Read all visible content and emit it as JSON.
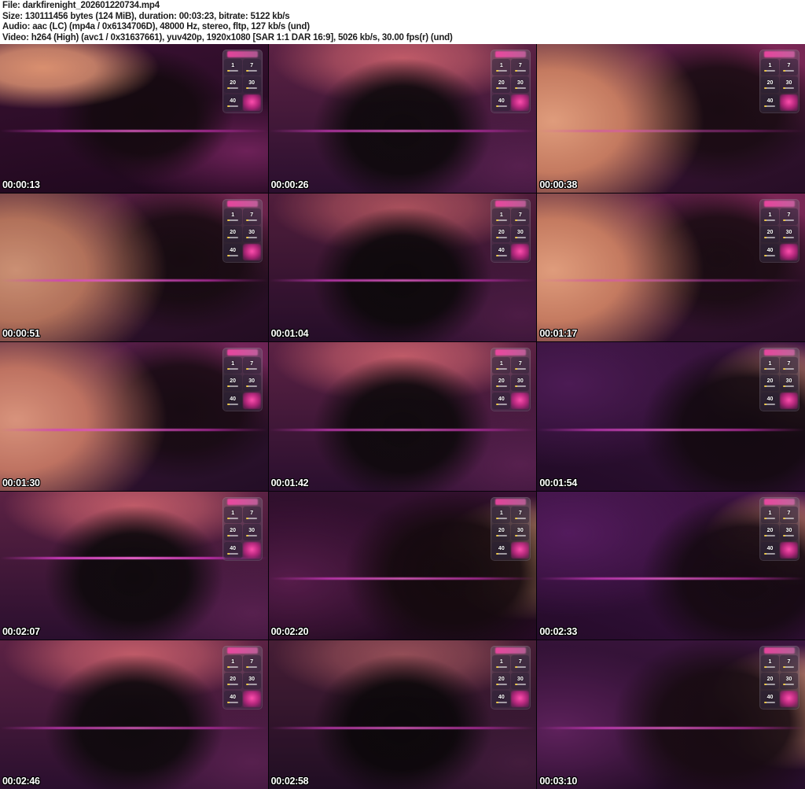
{
  "header": {
    "file": "File: darkfirenight_202601220734.mp4",
    "size": "Size: 130111456 bytes (124 MiB), duration: 00:03:23, bitrate: 5122 kb/s",
    "audio": "Audio: aac (LC) (mp4a / 0x6134706D), 48000 Hz, stereo, fltp, 127 kb/s (und)",
    "video": "Video: h264 (High) (avc1 / 0x31637661), yuv420p, 1920x1080 [SAR 1:1 DAR 16:9], 5026 kb/s, 30.00 fps(r) (und)"
  },
  "tip_overlay": {
    "tiles": [
      "1",
      "7",
      "20",
      "30",
      "40"
    ]
  },
  "thumbnails": [
    {
      "timestamp": "00:00:13",
      "palette": "pal-a"
    },
    {
      "timestamp": "00:00:26",
      "palette": "pal-b"
    },
    {
      "timestamp": "00:00:38",
      "palette": "pal-c"
    },
    {
      "timestamp": "00:00:51",
      "palette": "pal-c"
    },
    {
      "timestamp": "00:01:04",
      "palette": "pal-b"
    },
    {
      "timestamp": "00:01:17",
      "palette": "pal-c"
    },
    {
      "timestamp": "00:01:30",
      "palette": "pal-c"
    },
    {
      "timestamp": "00:01:42",
      "palette": "pal-b"
    },
    {
      "timestamp": "00:01:54",
      "palette": "pal-d"
    },
    {
      "timestamp": "00:02:07",
      "palette": "pal-b"
    },
    {
      "timestamp": "00:02:20",
      "palette": "pal-e"
    },
    {
      "timestamp": "00:02:33",
      "palette": "pal-d"
    },
    {
      "timestamp": "00:02:46",
      "palette": "pal-b"
    },
    {
      "timestamp": "00:02:58",
      "palette": "pal-b"
    },
    {
      "timestamp": "00:03:10",
      "palette": "pal-e"
    }
  ],
  "colors": {
    "header_text": "#1c1c1c",
    "header_background": "#ffffff",
    "timestamp_text": "#ffffff",
    "accent_magenta": "#e040d0",
    "scene_purple": "#3a1535",
    "scene_warm": "#d8907a"
  }
}
